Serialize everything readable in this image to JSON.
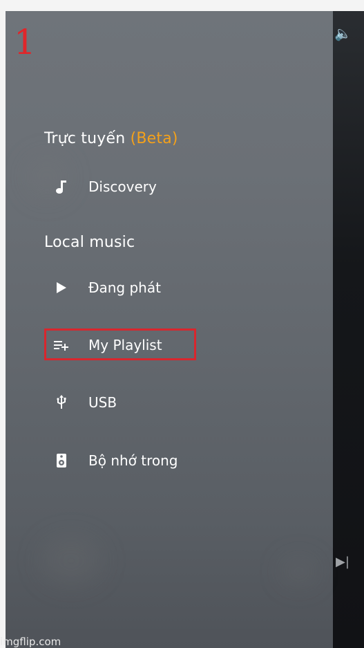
{
  "annotation": {
    "step_number": "1"
  },
  "drawer": {
    "online_section": {
      "label": "Trực tuyến",
      "badge": "(Beta)"
    },
    "online_items": [
      {
        "label": "Discovery",
        "icon": "music-note-icon"
      }
    ],
    "local_section": {
      "label": "Local music"
    },
    "local_items": [
      {
        "label": "Đang phát",
        "icon": "play-icon"
      },
      {
        "label": "My Playlist",
        "icon": "playlist-add-icon"
      },
      {
        "label": "USB",
        "icon": "usb-icon"
      },
      {
        "label": "Bộ nhớ trong",
        "icon": "speaker-icon"
      }
    ]
  },
  "watermark": "imgflip.com",
  "colors": {
    "beta": "#f4a11b",
    "highlight": "#d9262d",
    "annotation": "#e0262a"
  }
}
